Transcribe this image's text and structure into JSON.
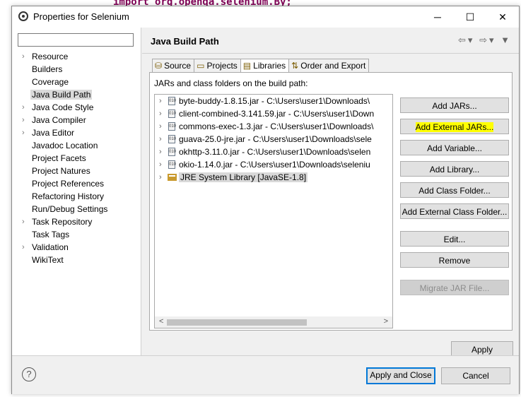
{
  "background": {
    "code_line": "import org.openqa.selenium.By;"
  },
  "window": {
    "title": "Properties for Selenium",
    "minimize": "─",
    "maximize": "☐",
    "close": "✕"
  },
  "sidebar": {
    "filter_value": "",
    "items": [
      {
        "label": "Resource",
        "expandable": true
      },
      {
        "label": "Builders",
        "expandable": false
      },
      {
        "label": "Coverage",
        "expandable": false
      },
      {
        "label": "Java Build Path",
        "expandable": false,
        "selected": true
      },
      {
        "label": "Java Code Style",
        "expandable": true
      },
      {
        "label": "Java Compiler",
        "expandable": true
      },
      {
        "label": "Java Editor",
        "expandable": true
      },
      {
        "label": "Javadoc Location",
        "expandable": false
      },
      {
        "label": "Project Facets",
        "expandable": false
      },
      {
        "label": "Project Natures",
        "expandable": false
      },
      {
        "label": "Project References",
        "expandable": false
      },
      {
        "label": "Refactoring History",
        "expandable": false
      },
      {
        "label": "Run/Debug Settings",
        "expandable": false
      },
      {
        "label": "Task Repository",
        "expandable": true
      },
      {
        "label": "Task Tags",
        "expandable": false
      },
      {
        "label": "Validation",
        "expandable": true
      },
      {
        "label": "WikiText",
        "expandable": false
      }
    ]
  },
  "page": {
    "title": "Java Build Path",
    "tabs": [
      {
        "label": "Source",
        "icon": "source-folder-icon"
      },
      {
        "label": "Projects",
        "icon": "projects-folder-icon"
      },
      {
        "label": "Libraries",
        "icon": "libraries-icon",
        "active": true
      },
      {
        "label": "Order and Export",
        "icon": "order-export-icon"
      }
    ],
    "caption": "JARs and class folders on the build path:",
    "entries": [
      {
        "label": "byte-buddy-1.8.15.jar - C:\\Users\\user1\\Downloads\\",
        "kind": "jar"
      },
      {
        "label": "client-combined-3.141.59.jar - C:\\Users\\user1\\Down",
        "kind": "jar"
      },
      {
        "label": "commons-exec-1.3.jar - C:\\Users\\user1\\Downloads\\",
        "kind": "jar"
      },
      {
        "label": "guava-25.0-jre.jar - C:\\Users\\user1\\Downloads\\sele",
        "kind": "jar"
      },
      {
        "label": "okhttp-3.11.0.jar - C:\\Users\\user1\\Downloads\\selen",
        "kind": "jar"
      },
      {
        "label": "okio-1.14.0.jar - C:\\Users\\user1\\Downloads\\seleniu",
        "kind": "jar"
      },
      {
        "label": "JRE System Library [JavaSE-1.8]",
        "kind": "jre"
      }
    ],
    "buttons": {
      "add_jars": "Add JARs...",
      "add_external_jars": "Add External JARs...",
      "add_variable": "Add Variable...",
      "add_library": "Add Library...",
      "add_class_folder": "Add Class Folder...",
      "add_external_class_folder": "Add External Class Folder...",
      "edit": "Edit...",
      "remove": "Remove",
      "migrate_jar": "Migrate JAR File..."
    },
    "apply": "Apply"
  },
  "footer": {
    "help": "?",
    "apply_and_close": "Apply and Close",
    "cancel": "Cancel"
  },
  "colors": {
    "highlight": "#ffff00",
    "focus": "#0078d7"
  }
}
